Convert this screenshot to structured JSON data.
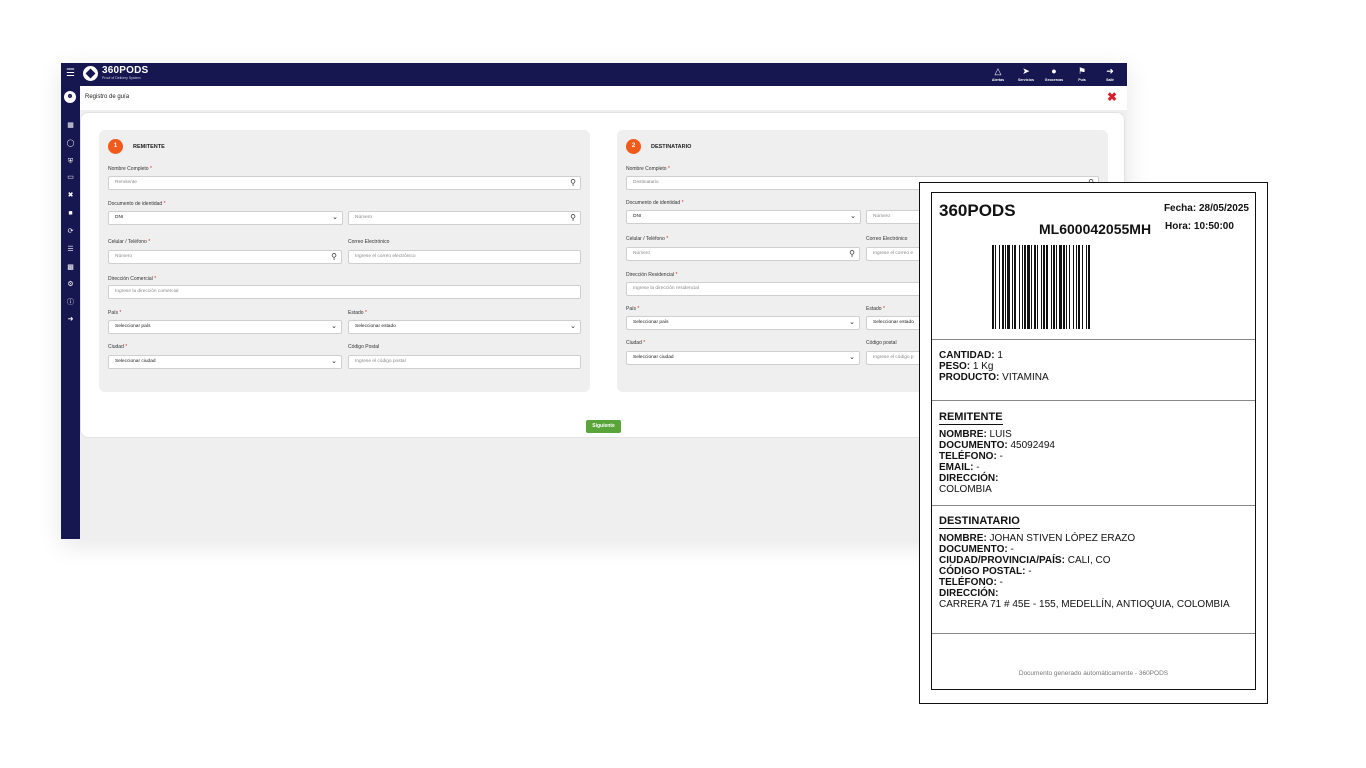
{
  "topbar": {
    "brand": "360PODS",
    "brand_sub": "Proof of Delivery System",
    "actions": [
      {
        "label": "Alertas",
        "icon": "bell-icon"
      },
      {
        "label": "Servicios",
        "icon": "send-icon"
      },
      {
        "label": "Geocercas",
        "icon": "map-pin-icon"
      },
      {
        "label": "Puis",
        "icon": "flag-icon"
      },
      {
        "label": "Salir",
        "icon": "logout-icon"
      }
    ]
  },
  "subheader": {
    "title": "Registro de guía"
  },
  "remitente": {
    "step": "1",
    "title": "REMITENTE",
    "nombre_label": "Nombre Completo",
    "nombre_placeholder": "Remitente",
    "documento_label": "Documento de identidad",
    "documento_tipo": "DNI",
    "documento_placeholder": "Número",
    "celular_label": "Celular / Teléfono",
    "celular_placeholder": "Número",
    "correo_label": "Correo Electrónico",
    "correo_placeholder": "Ingrese el correo electrónico",
    "direccion_label": "Dirección Comercial",
    "direccion_placeholder": "Ingrese la dirección comercial",
    "pais_label": "País",
    "pais_value": "Seleccionar país",
    "estado_label": "Estado",
    "estado_value": "Seleccionar estado",
    "ciudad_label": "Ciudad",
    "ciudad_value": "Seleccionar ciudad",
    "postal_label": "Código Postal",
    "postal_placeholder": "Ingrese el código postal"
  },
  "destinatario": {
    "step": "2",
    "title": "DESTINATARIO",
    "nombre_label": "Nombre Completo",
    "nombre_placeholder": "Destinatario",
    "documento_label": "Documento de identidad",
    "documento_tipo": "DNI",
    "documento_placeholder": "Número",
    "celular_label": "Celular / Teléfono",
    "celular_placeholder": "Número",
    "correo_label": "Correo Electrónico",
    "correo_placeholder": "Ingrese el correo e",
    "direccion_label": "Dirección Residencial",
    "direccion_placeholder": "Ingrese la dirección residencial",
    "pais_label": "País",
    "pais_value": "Seleccionar país",
    "estado_label": "Estado",
    "estado_value": "Seleccionar estado",
    "ciudad_label": "Ciudad",
    "ciudad_value": "Seleccionar ciudad",
    "postal_label": "Código postal",
    "postal_placeholder": "Ingrese el código p"
  },
  "required_mark": "*",
  "next_button": "Siguiente",
  "label": {
    "brand": "360PODS",
    "fecha": "Fecha: 28/05/2025",
    "code": "ML600042055MH",
    "hora": "Hora: 10:50:00",
    "cantidad_k": "CANTIDAD:",
    "cantidad_v": " 1",
    "peso_k": "PESO:",
    "peso_v": " 1 Kg",
    "producto_k": "PRODUCTO:",
    "producto_v": " VITAMINA",
    "rem_heading": "REMITENTE",
    "rem_nombre_k": "NOMBRE:",
    "rem_nombre_v": " LUIS",
    "rem_doc_k": "DOCUMENTO:",
    "rem_doc_v": " 45092494",
    "rem_tel_k": "TELÉFONO:",
    "rem_tel_v": " -",
    "rem_email_k": "EMAIL:",
    "rem_email_v": " -",
    "rem_dir_k": "DIRECCIÓN:",
    "rem_dir_v": "COLOMBIA",
    "dest_heading": "DESTINATARIO",
    "dest_nombre_k": "NOMBRE:",
    "dest_nombre_v": " JOHAN STIVEN LÓPEZ ERAZO",
    "dest_doc_k": "DOCUMENTO:",
    "dest_doc_v": " -",
    "dest_ciudad_k": "CIUDAD/PROVINCIA/PAÍS:",
    "dest_ciudad_v": " CALI, CO",
    "dest_postal_k": "CÓDIGO POSTAL:",
    "dest_postal_v": " -",
    "dest_tel_k": "TELÉFONO:",
    "dest_tel_v": " -",
    "dest_dir_k": "DIRECCIÓN:",
    "dest_dir_v": "CARRERA 71 # 45E - 155, MEDELLÍN, ANTIOQUIA, COLOMBIA",
    "footer": "Documento generado automáticamente - 360PODS"
  },
  "colors": {
    "nav": "#161650",
    "accent": "#f05a1a",
    "success": "#5aa53a",
    "danger": "#d6202e"
  }
}
